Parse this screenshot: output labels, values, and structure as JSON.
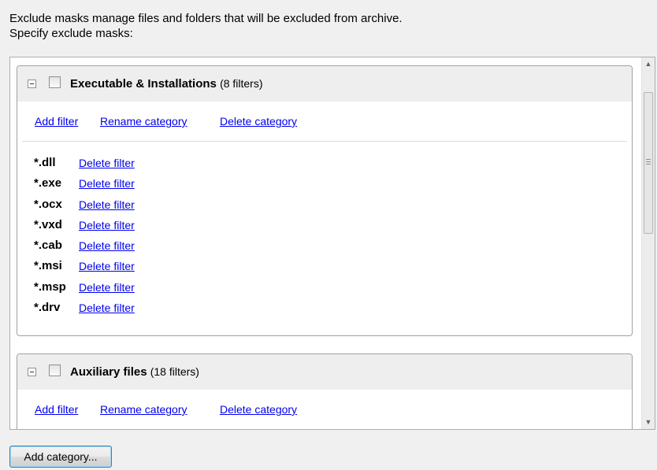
{
  "intro": {
    "line1": "Exclude masks manage files and folders that will be excluded from archive.",
    "line2": "Specify exclude masks:"
  },
  "categories": [
    {
      "name": "Executable & Installations",
      "count": "(8 filters)",
      "actions": {
        "add": "Add filter",
        "rename": "Rename category",
        "delete": "Delete category"
      },
      "filters": [
        {
          "mask": "*.dll",
          "action": "Delete filter"
        },
        {
          "mask": "*.exe",
          "action": "Delete filter"
        },
        {
          "mask": "*.ocx",
          "action": "Delete filter"
        },
        {
          "mask": "*.vxd",
          "action": "Delete filter"
        },
        {
          "mask": "*.cab",
          "action": "Delete filter"
        },
        {
          "mask": "*.msi",
          "action": "Delete filter"
        },
        {
          "mask": "*.msp",
          "action": "Delete filter"
        },
        {
          "mask": "*.drv",
          "action": "Delete filter"
        }
      ]
    },
    {
      "name": "Auxiliary files",
      "count": "(18 filters)",
      "actions": {
        "add": "Add filter",
        "rename": "Rename category",
        "delete": "Delete category"
      }
    }
  ],
  "buttons": {
    "add_category": "Add category..."
  },
  "colors": {
    "link": "#0000ee",
    "header_bg": "#eeeeee",
    "button_border": "#3c7fb1"
  }
}
